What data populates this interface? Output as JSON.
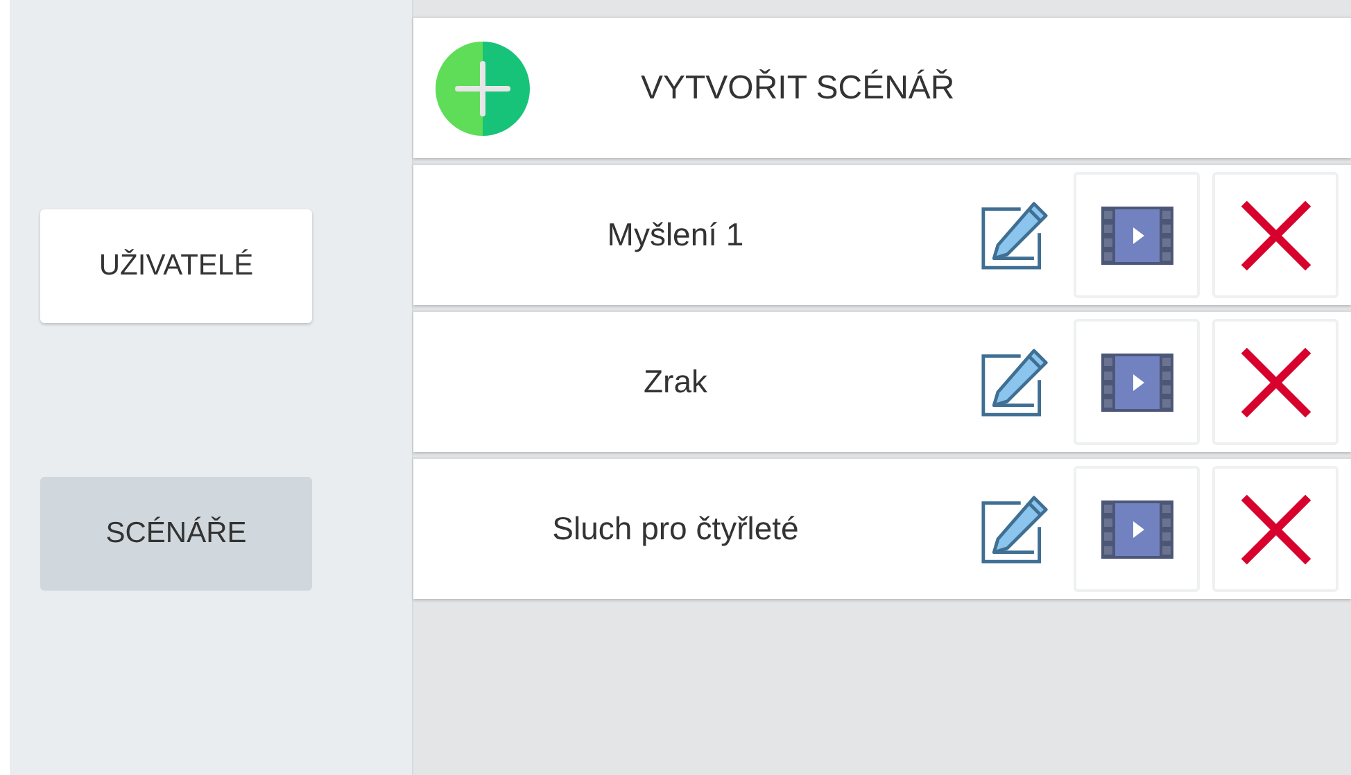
{
  "sidebar": {
    "items": [
      {
        "label": "UŽIVATELÉ",
        "selected": false
      },
      {
        "label": "SCÉNÁŘE",
        "selected": true
      }
    ]
  },
  "create_button": {
    "label": "VYTVOŘIT SCÉNÁŘ"
  },
  "scenarios": [
    {
      "name": "Myšlení 1"
    },
    {
      "name": "Zrak"
    },
    {
      "name": "Sluch pro čtyřleté"
    }
  ]
}
